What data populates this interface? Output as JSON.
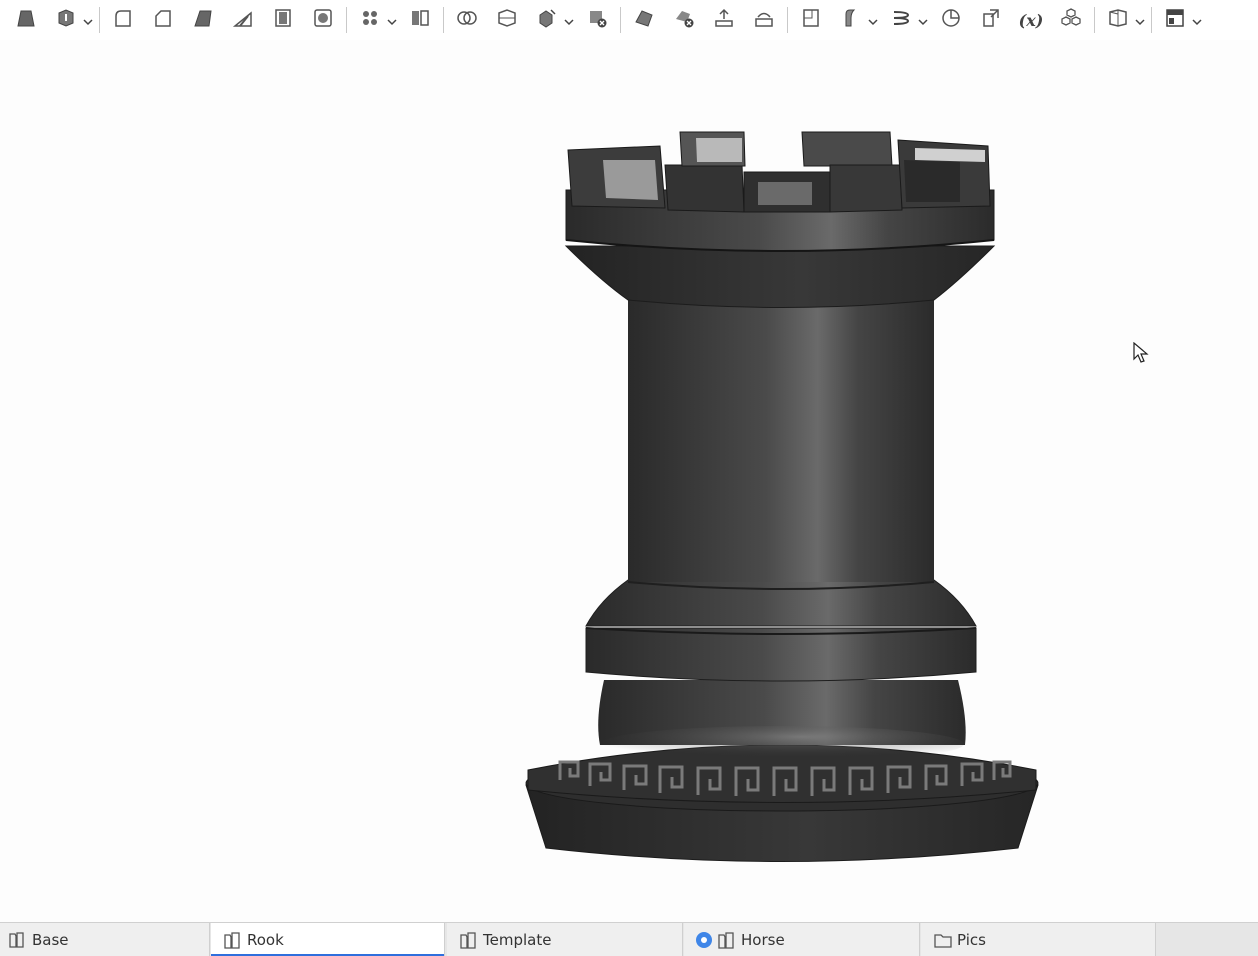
{
  "toolbar": {
    "icons": [
      "extrude-icon",
      "revolve-icon",
      "fillet-icon",
      "chamfer-icon",
      "draft-icon",
      "rib-icon",
      "shell-icon",
      "hole-icon",
      "pattern-icon",
      "mirror-icon",
      "boolean-icon",
      "split-icon",
      "transform-icon",
      "delete-part-icon",
      "modify-face-icon",
      "delete-face-icon",
      "move-face-icon",
      "replace-face-icon",
      "plane-icon",
      "sweep-icon",
      "helix-icon",
      "mate-connector-icon",
      "derive-icon",
      "variable-icon",
      "composite-part-icon",
      "sheet-metal-icon",
      "view-options-icon"
    ],
    "variable_label": "(x)"
  },
  "viewport": {
    "model": "chess-rook-model"
  },
  "tabs": [
    {
      "label": "Base",
      "icon": "part-studio-icon",
      "active": false
    },
    {
      "label": "Rook",
      "icon": "part-studio-icon",
      "active": true
    },
    {
      "label": "Template",
      "icon": "part-studio-icon",
      "active": false
    },
    {
      "label": "Horse",
      "icon": "part-studio-icon",
      "badge": "info-badge",
      "active": false
    },
    {
      "label": "Pics",
      "icon": "folder-icon",
      "active": false
    }
  ],
  "colors": {
    "accent": "#2f6fdd",
    "model": "#3a3a3a",
    "toolbar_icon": "#555555"
  }
}
